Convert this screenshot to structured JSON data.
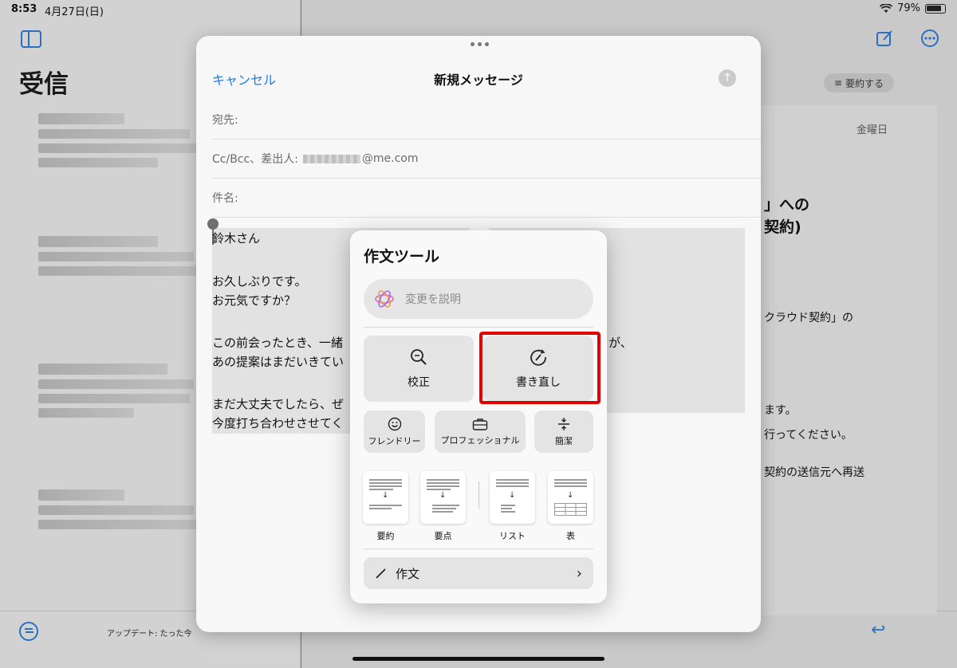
{
  "status_bar": {
    "time": "8:53",
    "date": "4月27日(日)",
    "battery": "79%"
  },
  "mail_list": {
    "title": "受信",
    "updated": "アップデート: たった今"
  },
  "reading_pane": {
    "summarize_label": "要約する",
    "day": "金曜日",
    "lines": [
      "」への",
      "契約)",
      "クラウド契約」の",
      "ます。",
      "行ってください。",
      "契約の送信元へ再送"
    ]
  },
  "compose": {
    "cancel": "キャンセル",
    "title": "新規メッセージ",
    "to_label": "宛先:",
    "cc_label": "Cc/Bcc、差出人:",
    "from_domain": "@me.com",
    "subject_label": "件名:",
    "body_lines": [
      "鈴木さん",
      "お久しぶりです。",
      "お元気ですか？",
      "この前会ったとき、一緒",
      "が、",
      "あの提案はまだいきてい",
      "まだ大丈夫でしたら、ぜ",
      "今度打ち合わせさせてく"
    ]
  },
  "writing_tools": {
    "title": "作文ツール",
    "describe_placeholder": "変更を説明",
    "proofread": "校正",
    "rewrite": "書き直し",
    "tones": [
      "フレンドリー",
      "プロフェッショナル",
      "簡潔"
    ],
    "formats": [
      "要約",
      "要点",
      "リスト",
      "表"
    ],
    "compose": "作文",
    "highlight_color": "#e00000"
  }
}
